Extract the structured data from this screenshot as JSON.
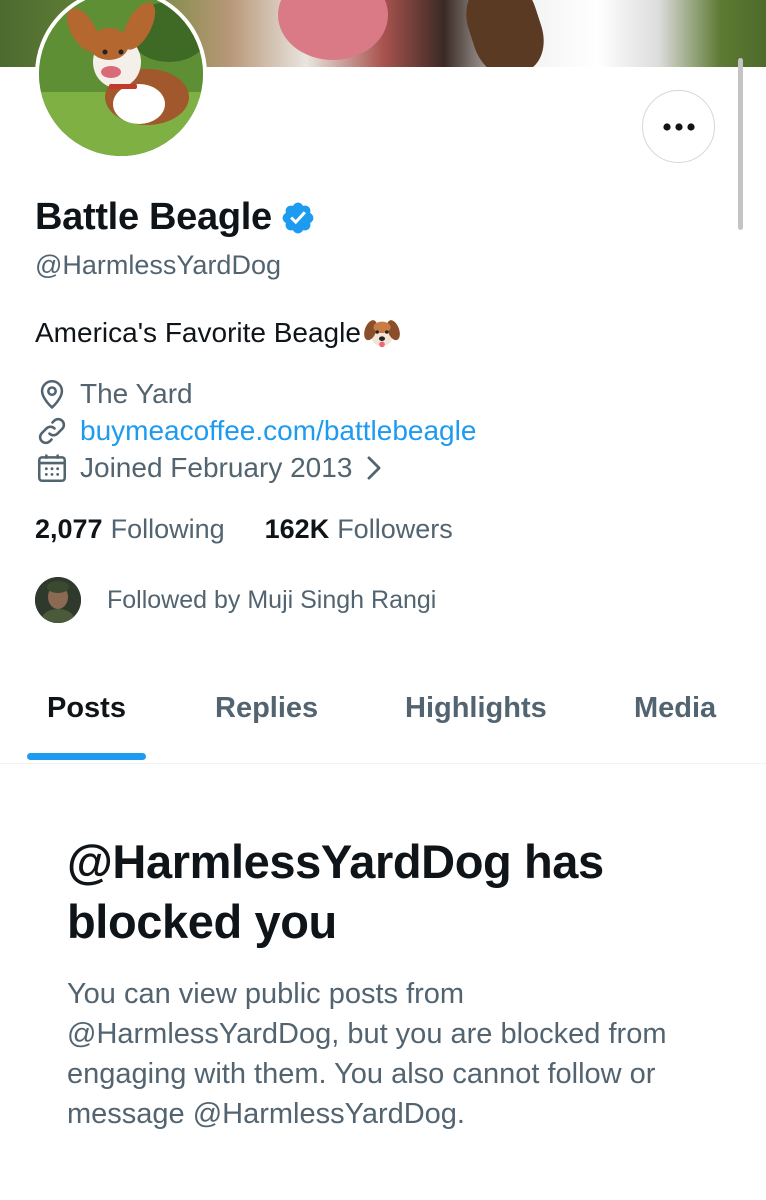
{
  "profile": {
    "display_name": "Battle Beagle",
    "handle": "@HarmlessYardDog",
    "bio": "America's Favorite Beagle",
    "bio_emoji": "dog-face-emoji",
    "location": "The Yard",
    "website": "buymeacoffee.com/battlebeagle",
    "joined": "Joined February 2013",
    "verified": true
  },
  "stats": {
    "following_count": "2,077",
    "following_label": "Following",
    "followers_count": "162K",
    "followers_label": "Followers"
  },
  "followed_by": {
    "text": "Followed by Muji Singh Rangi"
  },
  "tabs": [
    {
      "label": "Posts",
      "active": true
    },
    {
      "label": "Replies",
      "active": false
    },
    {
      "label": "Highlights",
      "active": false
    },
    {
      "label": "Media",
      "active": false
    }
  ],
  "blocked": {
    "title": "@HarmlessYardDog has blocked you",
    "body": "You can view public posts from @HarmlessYardDog, but you are blocked from engaging with them. You also cannot follow or message @HarmlessYardDog."
  },
  "colors": {
    "accent": "#1d9bf0",
    "text_primary": "#0f1419",
    "text_secondary": "#536471"
  }
}
